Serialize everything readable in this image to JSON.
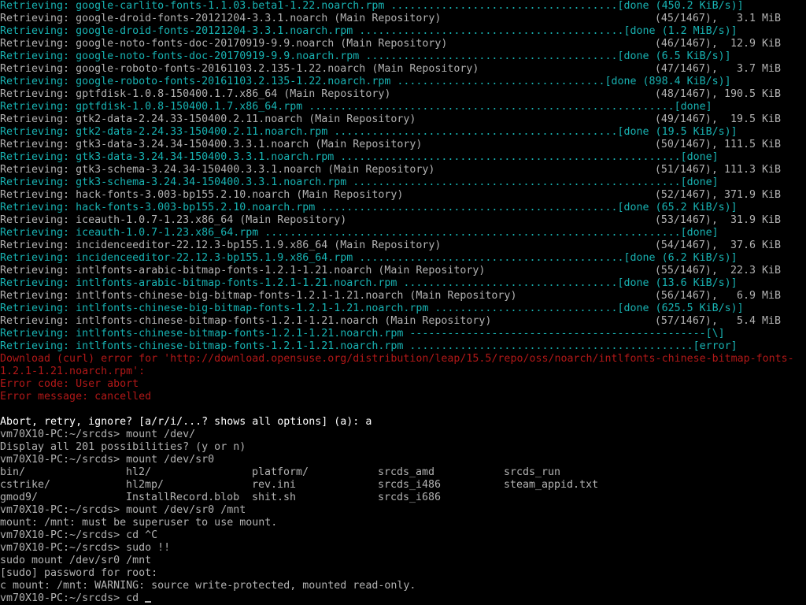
{
  "colors": {
    "background": "#000000",
    "text": "#b2b2b2",
    "success": "#18b2b2",
    "error": "#b21818",
    "emphasis": "#ffffff"
  },
  "terminal": {
    "progress_lines": [
      {
        "kind": "dl",
        "text": "Retrieving: google-carlito-fonts-1.1.03.beta1-1.22.noarch.rpm ....................................[done (450.2 KiB/s)]"
      },
      {
        "kind": "info",
        "left": "Retrieving: google-droid-fonts-20121204-3.3.1.noarch (Main Repository)",
        "right": "(45/1467),   3.1 MiB"
      },
      {
        "kind": "dl",
        "text": "Retrieving: google-droid-fonts-20121204-3.3.1.noarch.rpm ..........................................[done (1.2 MiB/s)]"
      },
      {
        "kind": "info",
        "left": "Retrieving: google-noto-fonts-doc-20170919-9.9.noarch (Main Repository)",
        "right": "(46/1467),  12.9 KiB"
      },
      {
        "kind": "dl",
        "text": "Retrieving: google-noto-fonts-doc-20170919-9.9.noarch.rpm ........................................[done (6.5 KiB/s)]"
      },
      {
        "kind": "info",
        "left": "Retrieving: google-roboto-fonts-20161103.2.135-1.22.noarch (Main Repository)",
        "right": "(47/1467),   3.7 MiB"
      },
      {
        "kind": "dl",
        "text": "Retrieving: google-roboto-fonts-20161103.2.135-1.22.noarch.rpm .................................[done (898.4 KiB/s)]"
      },
      {
        "kind": "info",
        "left": "Retrieving: gptfdisk-1.0.8-150400.1.7.x86_64 (Main Repository)",
        "right": "(48/1467), 190.5 KiB"
      },
      {
        "kind": "dl",
        "text": "Retrieving: gptfdisk-1.0.8-150400.1.7.x86_64.rpm ..........................................................[done]"
      },
      {
        "kind": "info",
        "left": "Retrieving: gtk2-data-2.24.33-150400.2.11.noarch (Main Repository)",
        "right": "(49/1467),  19.5 KiB"
      },
      {
        "kind": "dl",
        "text": "Retrieving: gtk2-data-2.24.33-150400.2.11.noarch.rpm .............................................[done (19.5 KiB/s)]"
      },
      {
        "kind": "info",
        "left": "Retrieving: gtk3-data-3.24.34-150400.3.3.1.noarch (Main Repository)",
        "right": "(50/1467), 111.5 KiB"
      },
      {
        "kind": "dl",
        "text": "Retrieving: gtk3-data-3.24.34-150400.3.3.1.noarch.rpm ......................................................[done]"
      },
      {
        "kind": "info",
        "left": "Retrieving: gtk3-schema-3.24.34-150400.3.3.1.noarch (Main Repository)",
        "right": "(51/1467), 111.3 KiB"
      },
      {
        "kind": "dl",
        "text": "Retrieving: gtk3-schema-3.24.34-150400.3.3.1.noarch.rpm ....................................................[done]"
      },
      {
        "kind": "info",
        "left": "Retrieving: hack-fonts-3.003-bp155.2.10.noarch (Main Repository)",
        "right": "(52/1467), 371.9 KiB"
      },
      {
        "kind": "dl",
        "text": "Retrieving: hack-fonts-3.003-bp155.2.10.noarch.rpm ...............................................[done (65.2 KiB/s)]"
      },
      {
        "kind": "info",
        "left": "Retrieving: iceauth-1.0.7-1.23.x86_64 (Main Repository)",
        "right": "(53/1467),  31.9 KiB"
      },
      {
        "kind": "dl",
        "text": "Retrieving: iceauth-1.0.7-1.23.x86_64.rpm ..................................................................[done]"
      },
      {
        "kind": "info",
        "left": "Retrieving: incidenceeditor-22.12.3-bp155.1.9.x86_64 (Main Repository)",
        "right": "(54/1467),  37.6 KiB"
      },
      {
        "kind": "dl",
        "text": "Retrieving: incidenceeditor-22.12.3-bp155.1.9.x86_64.rpm ..........................................[done (6.2 KiB/s)]"
      },
      {
        "kind": "info",
        "left": "Retrieving: intlfonts-arabic-bitmap-fonts-1.2.1-1.21.noarch (Main Repository)",
        "right": "(55/1467),  22.3 KiB"
      },
      {
        "kind": "dl",
        "text": "Retrieving: intlfonts-arabic-bitmap-fonts-1.2.1-1.21.noarch.rpm ..................................[done (13.6 KiB/s)]"
      },
      {
        "kind": "info",
        "left": "Retrieving: intlfonts-chinese-big-bitmap-fonts-1.2.1-1.21.noarch (Main Repository)",
        "right": "(56/1467),   6.9 MiB"
      },
      {
        "kind": "dl",
        "text": "Retrieving: intlfonts-chinese-big-bitmap-fonts-1.2.1-1.21.noarch.rpm .............................[done (625.5 KiB/s)]"
      },
      {
        "kind": "info",
        "left": "Retrieving: intlfonts-chinese-bitmap-fonts-1.2.1-1.21.noarch (Main Repository)",
        "right": "(57/1467),   5.4 MiB"
      },
      {
        "kind": "dl",
        "text": "Retrieving: intlfonts-chinese-bitmap-fonts-1.2.1-1.21.noarch.rpm -----------------------------------------------[\\]"
      },
      {
        "kind": "dl",
        "text": "Retrieving: intlfonts-chinese-bitmap-fonts-1.2.1-1.21.noarch.rpm .............................................[error]"
      }
    ],
    "error_lines": [
      "Download (curl) error for 'http://download.opensuse.org/distribution/leap/15.5/repo/oss/noarch/intlfonts-chinese-bitmap-fonts-1.2.1-1.21.noarch.rpm':",
      "Error code: User abort",
      "Error message: cancelled"
    ],
    "prompt_question": "Abort, retry, ignore? [a/r/i/...? shows all options] (a): a",
    "session_before_ls": [
      "vm70X10-PC:~/srcds> mount /dev/",
      "Display all 201 possibilities? (y or n)",
      "vm70X10-PC:~/srcds> mount /dev/sr0"
    ],
    "ls_rows": [
      [
        "bin/",
        "hl2/",
        "platform/",
        "srcds_amd",
        "srcds_run"
      ],
      [
        "cstrike/",
        "hl2mp/",
        "rev.ini",
        "srcds_i486",
        "steam_appid.txt"
      ],
      [
        "gmod9/",
        "InstallRecord.blob",
        "shit.sh",
        "srcds_i686",
        ""
      ]
    ],
    "session_after_ls": [
      "vm70X10-PC:~/srcds> mount /dev/sr0 /mnt",
      "mount: /mnt: must be superuser to use mount.",
      "vm70X10-PC:~/srcds> cd ^C",
      "vm70X10-PC:~/srcds> sudo !!",
      "sudo mount /dev/sr0 /mnt",
      "[sudo] password for root:",
      "c mount: /mnt: WARNING: source write-protected, mounted read-only."
    ],
    "current_prompt": "vm70X10-PC:~/srcds> cd "
  }
}
